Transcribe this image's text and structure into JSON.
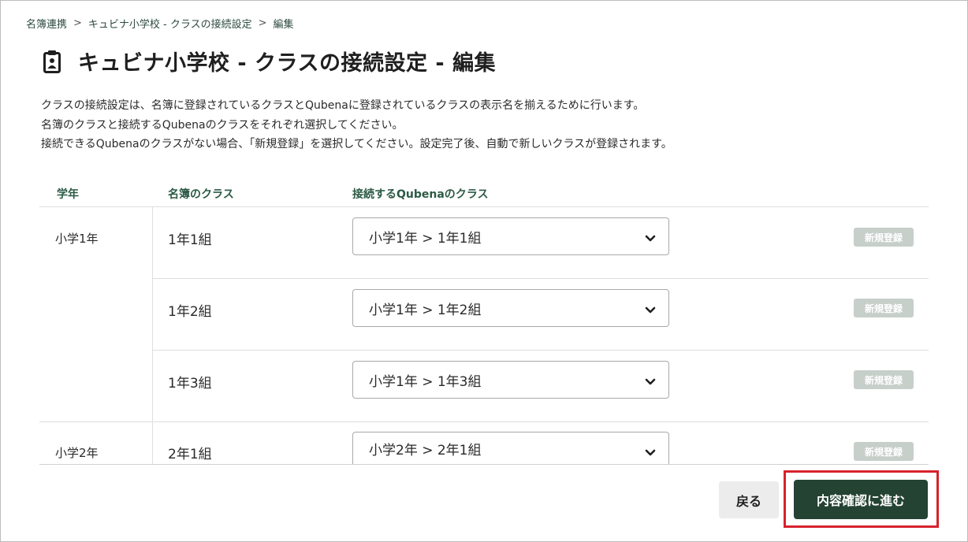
{
  "breadcrumb": {
    "items": [
      "名簿連携",
      "キュビナ小学校 - クラスの接続設定",
      "編集"
    ],
    "separator": ">"
  },
  "page": {
    "title": "キュビナ小学校 - クラスの接続設定 - 編集",
    "icon": "clipboard-badge-icon"
  },
  "description": {
    "line1": "クラスの接続設定は、名簿に登録されているクラスとQubenaに登録されているクラスの表示名を揃えるために行います。",
    "line2": "名簿のクラスと接続するQubenaのクラスをそれぞれ選択してください。",
    "line3": "接続できるQubenaのクラスがない場合、「新規登録」を選択してください。設定完了後、自動で新しいクラスが登録されます。"
  },
  "table": {
    "headers": {
      "grade": "学年",
      "roster_class": "名簿のクラス",
      "qubena_class": "接続するQubenaのクラス"
    },
    "rows": [
      {
        "grade": "小学1年",
        "roster_class": "1年1組",
        "selected": "小学1年 > 1年1組",
        "new_label": "新規登録"
      },
      {
        "grade": "",
        "roster_class": "1年2組",
        "selected": "小学1年 > 1年2組",
        "new_label": "新規登録"
      },
      {
        "grade": "",
        "roster_class": "1年3組",
        "selected": "小学1年 > 1年3組",
        "new_label": "新規登録"
      },
      {
        "grade": "小学2年",
        "roster_class": "2年1組",
        "selected": "小学2年 > 2年1組",
        "new_label": "新規登録"
      }
    ]
  },
  "actions": {
    "back_label": "戻る",
    "next_label": "内容確認に進む"
  },
  "colors": {
    "primary": "#244333",
    "header_text": "#2c5a45",
    "highlight": "#d6222c",
    "disabled_button": "#c7cfcb"
  }
}
